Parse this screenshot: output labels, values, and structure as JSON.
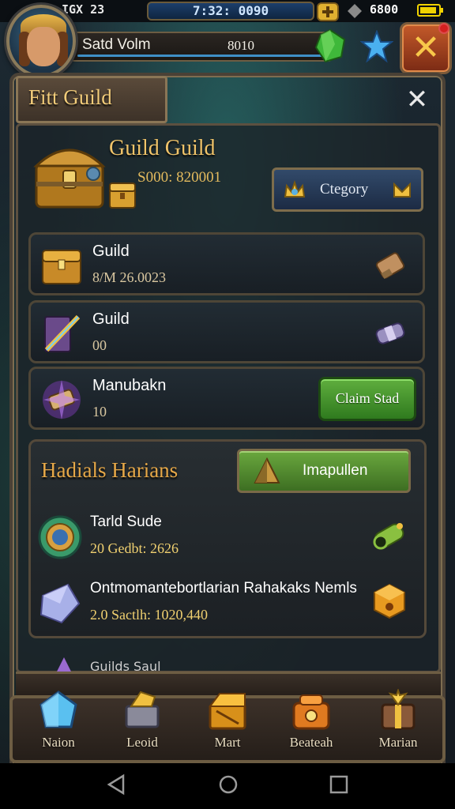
{
  "status_bar": {
    "left_text": "IGX 23",
    "clock": "7:32: 0090",
    "plus_icon": "plus-badge-icon",
    "resource_icon": "diamond-icon",
    "resource_value": "6800"
  },
  "player": {
    "name": "Satd Volm",
    "value": "8010"
  },
  "panel": {
    "title": "Fitt Guild",
    "close_glyph": "✕"
  },
  "guild_header": {
    "title": "Guild Guild",
    "subtitle": "S000: 820001",
    "category_button": "Ctegory"
  },
  "rows": [
    {
      "title": "Guild",
      "subtitle": "8/M 26.0023",
      "icon": "chest-icon",
      "right_icon": "scroll-icon"
    },
    {
      "title": "Guild",
      "subtitle": "00",
      "icon": "book-sword-icon",
      "right_icon": "bandage-icon"
    },
    {
      "title": "Manubakn",
      "subtitle": "10",
      "icon": "magic-scroll-icon",
      "button": "Claim Stad"
    }
  ],
  "rewards": {
    "title": "Hadials Harians",
    "button": "Imapullen",
    "items": [
      {
        "title": "Tarld Sude",
        "subtitle": "20 Gedbt: 2626",
        "icon": "amulet-icon",
        "right_icon": "cannon-icon"
      },
      {
        "title": "Ontmomantebortlarian Rahakaks Nemls",
        "subtitle": "2.0 Sactlh: 1020,440",
        "icon": "crystal-icon",
        "right_icon": "gold-box-icon"
      }
    ],
    "peek_text": "Guilds Saul"
  },
  "bottom_nav": [
    {
      "label": "Naion",
      "icon": "blue-gem-icon"
    },
    {
      "label": "Leoid",
      "icon": "anvil-icon"
    },
    {
      "label": "Mart",
      "icon": "gold-chest-icon"
    },
    {
      "label": "Beateah",
      "icon": "treasure-box-icon"
    },
    {
      "label": "Marian",
      "icon": "gift-box-icon"
    }
  ],
  "system_nav": [
    "back",
    "home",
    "recents"
  ],
  "colors": {
    "gold": "#f0c46a",
    "green_button": "#4f9a30",
    "close_red": "#c45a2a",
    "panel_border": "#5c5040"
  }
}
